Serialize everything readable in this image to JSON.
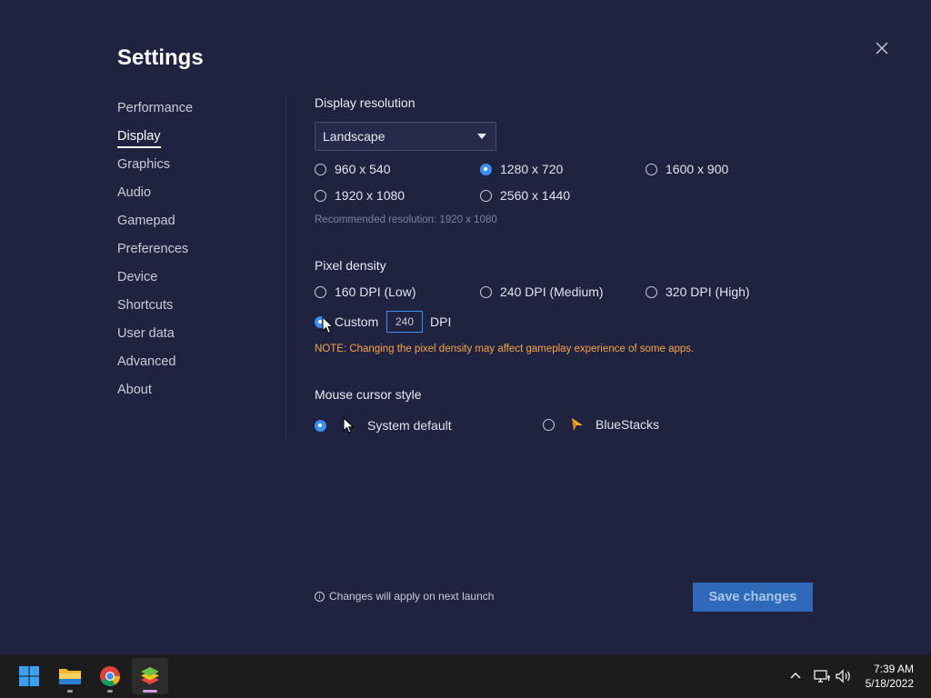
{
  "window": {
    "title": "Settings"
  },
  "nav": {
    "items": [
      {
        "label": "Performance"
      },
      {
        "label": "Display"
      },
      {
        "label": "Graphics"
      },
      {
        "label": "Audio"
      },
      {
        "label": "Gamepad"
      },
      {
        "label": "Preferences"
      },
      {
        "label": "Device"
      },
      {
        "label": "Shortcuts"
      },
      {
        "label": "User data"
      },
      {
        "label": "Advanced"
      },
      {
        "label": "About"
      }
    ],
    "active": "Display"
  },
  "display_resolution": {
    "label": "Display resolution",
    "orientation": "Landscape",
    "options": [
      "960 x 540",
      "1280 x 720",
      "1600 x 900",
      "1920 x 1080",
      "2560 x 1440"
    ],
    "selected": "1280 x 720",
    "hint": "Recommended resolution: 1920 x 1080"
  },
  "pixel_density": {
    "label": "Pixel density",
    "options": [
      "160 DPI (Low)",
      "240 DPI (Medium)",
      "320 DPI (High)"
    ],
    "custom_label": "Custom",
    "custom_value": "240",
    "unit": "DPI",
    "selected": "Custom",
    "note": "NOTE: Changing the pixel density may affect gameplay experience of some apps."
  },
  "mouse_cursor": {
    "label": "Mouse cursor style",
    "options": [
      "System default",
      "BlueStacks"
    ],
    "selected": "System default"
  },
  "footer": {
    "info": "Changes will apply on next launch",
    "save_label": "Save changes"
  },
  "taskbar": {
    "apps": [
      "start-icon",
      "file-explorer-icon",
      "chrome-icon",
      "bluestacks-icon"
    ],
    "time": "7:39 AM",
    "date": "5/18/2022"
  },
  "colors": {
    "background": "#1f2340",
    "accent": "#3d8ef5",
    "note": "#f5a54a",
    "button": "#2e6ab8"
  }
}
